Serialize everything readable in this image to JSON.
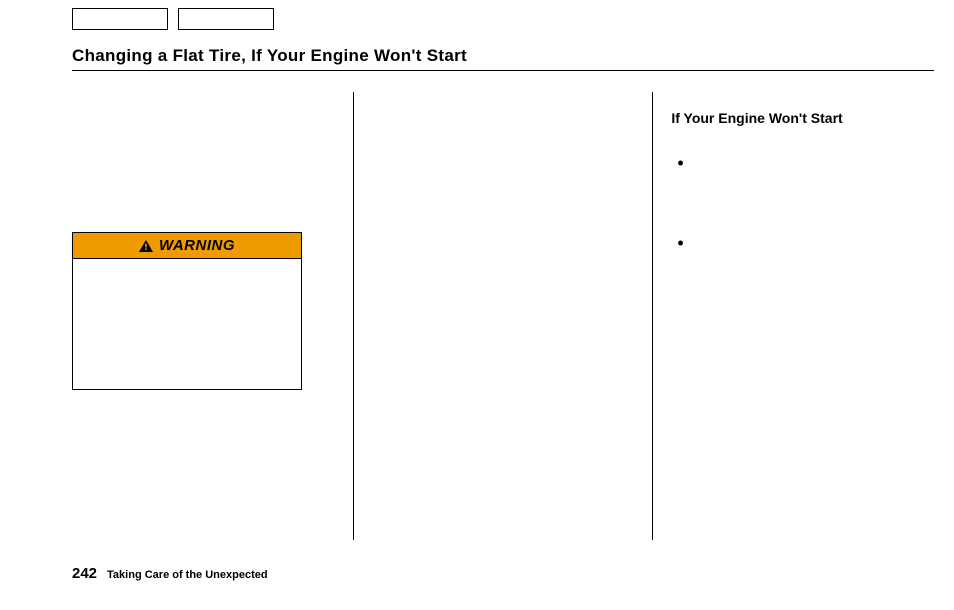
{
  "header": {
    "title": "Changing a Flat Tire, If Your Engine Won't Start"
  },
  "columns": {
    "left": {
      "warning": {
        "label": "WARNING"
      }
    },
    "right": {
      "heading": "If Your Engine Won't Start",
      "bullets": [
        "",
        ""
      ]
    }
  },
  "footer": {
    "page_number": "242",
    "section_title": "Taking Care of the Unexpected"
  }
}
